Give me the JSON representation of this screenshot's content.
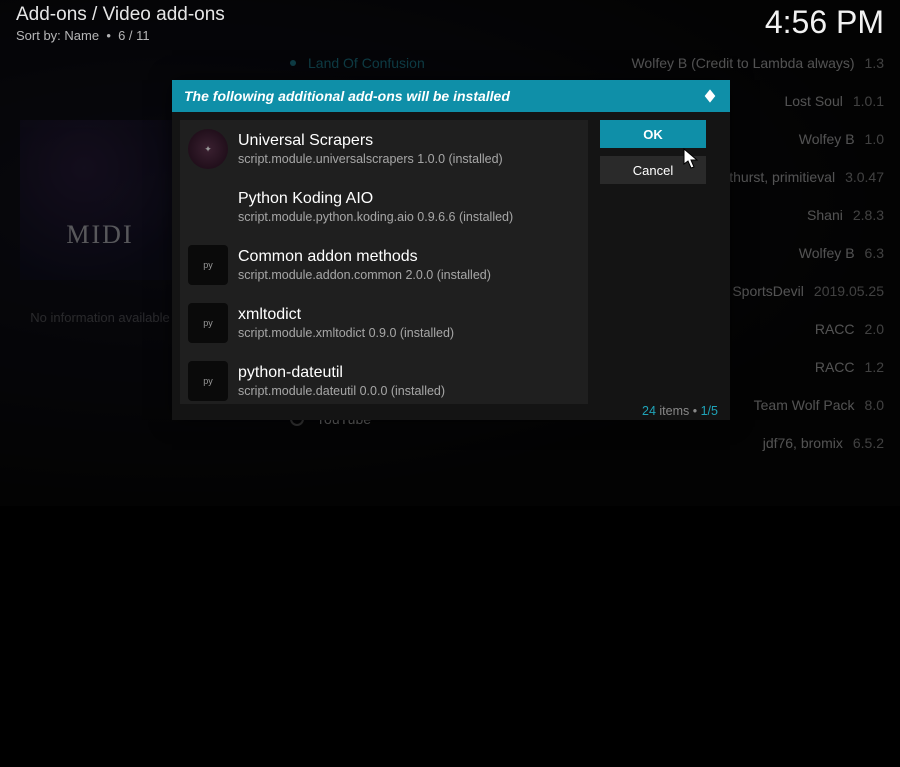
{
  "header": {
    "breadcrumb": "Add-ons / Video add-ons",
    "sort_label": "Sort by: Name",
    "position": "6 / 11",
    "clock": "4:56 PM"
  },
  "background": {
    "poster_text": "MIDI",
    "noinfo": "No information available",
    "top_item": {
      "label": "Land Of Confusion"
    },
    "bottom_item": {
      "label": "YouTube"
    },
    "right_items": [
      {
        "name": "Wolfey B (Credit to Lambda always)",
        "ver": "1.3"
      },
      {
        "name": "Lost Soul",
        "ver": "1.0.1"
      },
      {
        "name": "Wolfey B",
        "ver": "1.0"
      },
      {
        "name": "d, thurst, primitieval",
        "ver": "3.0.47"
      },
      {
        "name": "Shani",
        "ver": "2.8.3"
      },
      {
        "name": "Wolfey B",
        "ver": "6.3"
      },
      {
        "name": "SportsDevil",
        "ver": "2019.05.25"
      },
      {
        "name": "RACC",
        "ver": "2.0"
      },
      {
        "name": "RACC",
        "ver": "1.2"
      },
      {
        "name": "Team Wolf Pack",
        "ver": "8.0"
      },
      {
        "name": "jdf76, bromix",
        "ver": "6.5.2"
      }
    ]
  },
  "dialog": {
    "title": "The following additional add-ons will be installed",
    "buttons": {
      "ok": "OK",
      "cancel": "Cancel"
    },
    "footer": {
      "count": "24",
      "items_label": "items",
      "page": "1/5"
    },
    "addons": [
      {
        "name": "Universal Scrapers",
        "detail": "script.module.universalscrapers 1.0.0 (installed)",
        "icon": "logo"
      },
      {
        "name": "Python Koding AIO",
        "detail": "script.module.python.koding.aio 0.9.6.6 (installed)",
        "icon": "none"
      },
      {
        "name": "Common addon methods",
        "detail": "script.module.addon.common 2.0.0 (installed)",
        "icon": "python"
      },
      {
        "name": "xmltodict",
        "detail": "script.module.xmltodict 0.9.0 (installed)",
        "icon": "python"
      },
      {
        "name": "python-dateutil",
        "detail": "script.module.dateutil 0.0.0 (installed)",
        "icon": "python"
      }
    ]
  }
}
